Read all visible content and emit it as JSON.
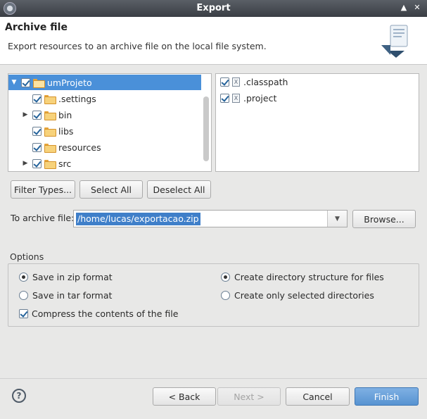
{
  "window": {
    "title": "Export"
  },
  "header": {
    "title": "Archive file",
    "description": "Export resources to an archive file on the local file system."
  },
  "tree": {
    "root": {
      "label": "umProjeto",
      "checked": true,
      "expanded": true
    },
    "items": [
      {
        "label": ".settings",
        "checked": true,
        "expandable": false
      },
      {
        "label": "bin",
        "checked": true,
        "expandable": true
      },
      {
        "label": "libs",
        "checked": true,
        "expandable": false
      },
      {
        "label": "resources",
        "checked": true,
        "expandable": false
      },
      {
        "label": "src",
        "checked": true,
        "expandable": true
      }
    ]
  },
  "files": [
    {
      "label": ".classpath",
      "checked": true,
      "icon": "x-file-icon"
    },
    {
      "label": ".project",
      "checked": true,
      "icon": "x-file-icon"
    }
  ],
  "buttons": {
    "filter_types": "Filter Types...",
    "select_all": "Select All",
    "deselect_all": "Deselect All",
    "browse": "Browse...",
    "back": "< Back",
    "next": "Next >",
    "cancel": "Cancel",
    "finish": "Finish"
  },
  "archive": {
    "label": "To archive file:",
    "value": "/home/lucas/exportacao.zip"
  },
  "options": {
    "label": "Options",
    "zip": "Save in zip format",
    "tar": "Save in tar format",
    "compress": "Compress the contents of the file",
    "create_structure": "Create directory structure for files",
    "selected_only": "Create only selected directories"
  },
  "colors": {
    "selection": "#4a90d9",
    "primary_button": "#5793d1"
  }
}
